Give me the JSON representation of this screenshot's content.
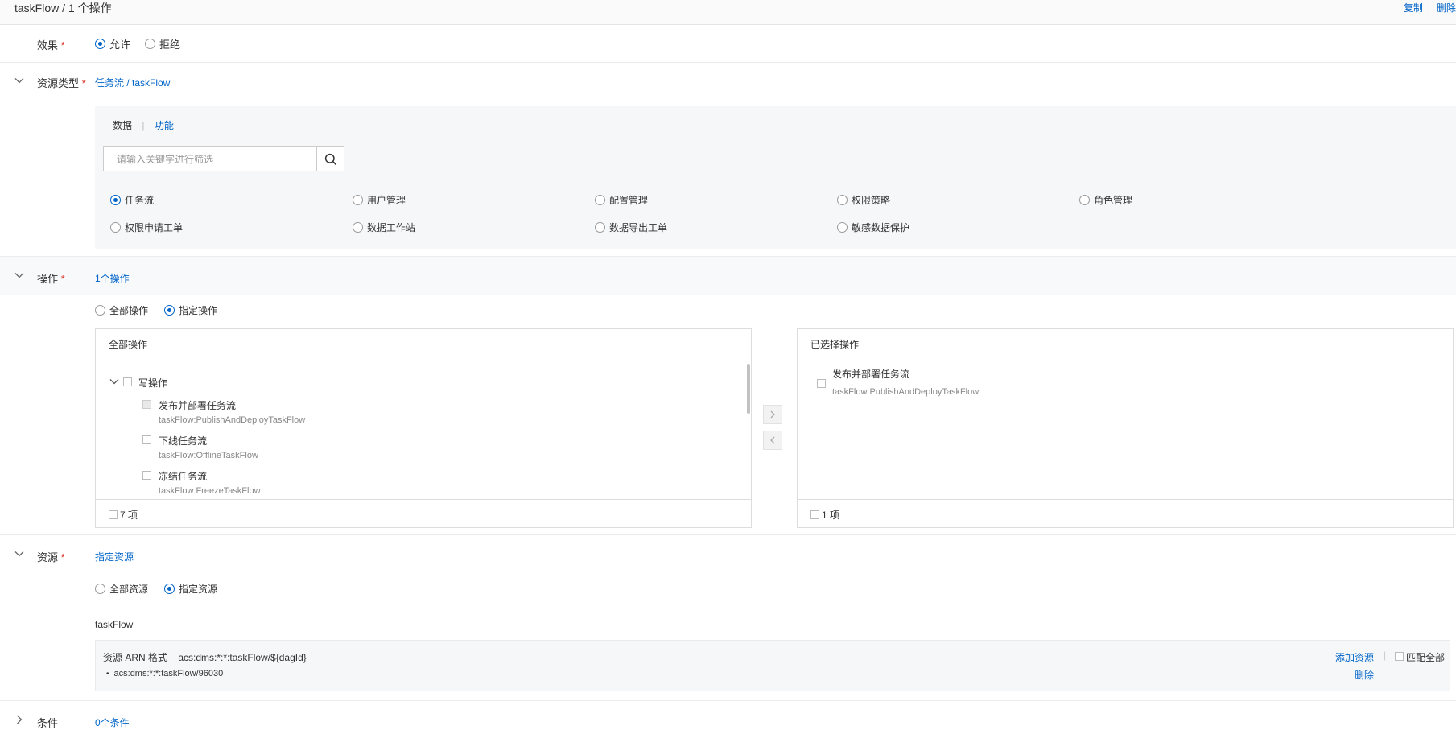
{
  "header": {
    "title": "taskFlow / 1 个操作",
    "copy_label": "复制",
    "delete_label": "删除"
  },
  "effect": {
    "label": "效果",
    "required_mark": "*",
    "options": [
      "允许",
      "拒绝"
    ],
    "selected": "允许"
  },
  "resource_type": {
    "label": "资源类型",
    "required_mark": "*",
    "value": "任务流 / taskFlow",
    "tabs": [
      "数据",
      "功能"
    ],
    "tab_separator": "|",
    "active_tab": "数据",
    "search_placeholder": "请输入关键字进行筛选",
    "types_row1": [
      "任务流",
      "用户管理",
      "配置管理",
      "权限策略",
      "角色管理"
    ],
    "types_row2": [
      "权限申请工单",
      "数据工作站",
      "数据导出工单",
      "敏感数据保护"
    ],
    "selected_type": "任务流"
  },
  "operation": {
    "label": "操作",
    "required_mark": "*",
    "summary": "1个操作",
    "options": [
      "全部操作",
      "指定操作"
    ],
    "selected": "指定操作",
    "left_panel": {
      "title": "全部操作",
      "group": "写操作",
      "items": [
        {
          "name": "发布并部署任务流",
          "code": "taskFlow:PublishAndDeployTaskFlow"
        },
        {
          "name": "下线任务流",
          "code": "taskFlow:OfflineTaskFlow"
        },
        {
          "name": "冻结任务流",
          "code": "taskFlow:FreezeTaskFlow"
        }
      ],
      "footer": "7 项"
    },
    "right_panel": {
      "title": "已选择操作",
      "items": [
        {
          "name": "发布并部署任务流",
          "code": "taskFlow:PublishAndDeployTaskFlow"
        }
      ],
      "footer": "1 项"
    }
  },
  "resource": {
    "label": "资源",
    "required_mark": "*",
    "summary": "指定资源",
    "options": [
      "全部资源",
      "指定资源"
    ],
    "selected": "指定资源",
    "subtitle": "taskFlow",
    "arn_format_label": "资源 ARN 格式",
    "arn_format_value": "acs:dms:*:*:taskFlow/${dagId}",
    "arn_items": [
      "acs:dms:*:*:taskFlow/96030"
    ],
    "add_label": "添加资源",
    "match_all_label": "匹配全部",
    "delete_label": "删除"
  },
  "condition": {
    "label": "条件",
    "summary": "0个条件"
  },
  "colors": {
    "accent": "#0064c8",
    "required": "#d93026",
    "panel_bg": "#f5f7f9"
  }
}
